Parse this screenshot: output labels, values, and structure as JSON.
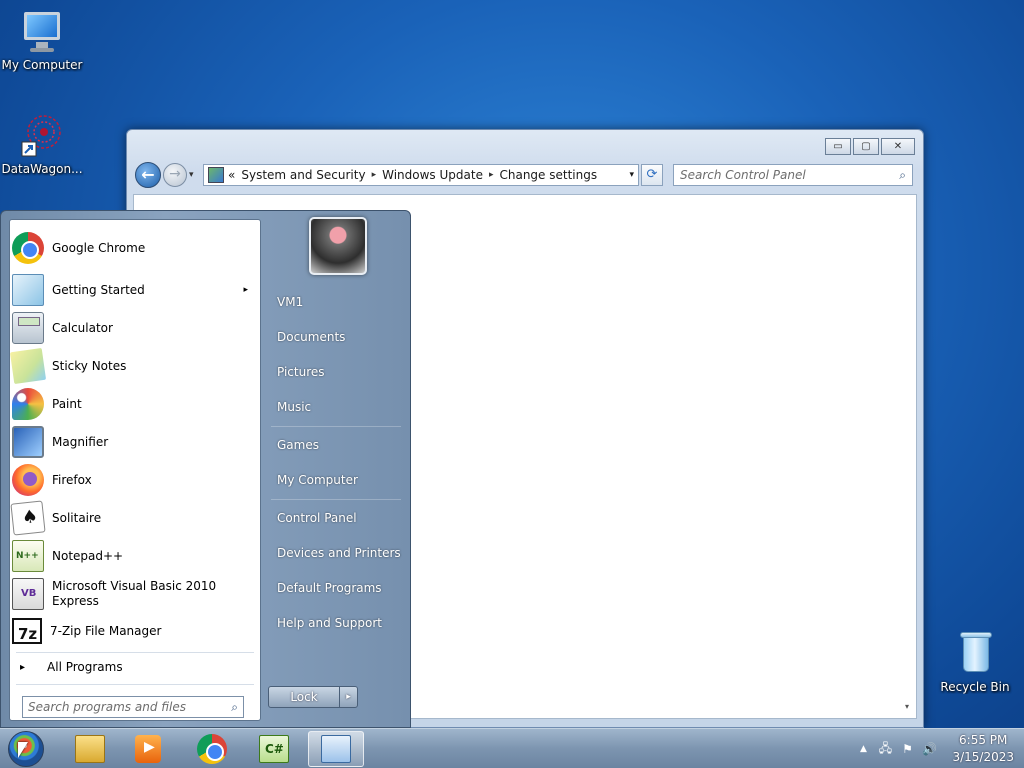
{
  "desktop": {
    "icons": [
      {
        "label": "My Computer"
      },
      {
        "label": "DataWagon..."
      },
      {
        "label": "Recycle Bin"
      }
    ]
  },
  "window": {
    "controls": {
      "minimize": "▭",
      "maximize": "▢",
      "close": "✕"
    },
    "nav": {
      "back": "←",
      "forward": "→",
      "dropdown": "▾"
    },
    "breadcrumb": {
      "prefix": "«",
      "items": [
        "System and Security",
        "Windows Update",
        "Change settings"
      ],
      "separator": "▸",
      "dropdown": "▾"
    },
    "refresh": "⟳",
    "search": {
      "placeholder": "Search Control Panel",
      "icon": "⌕"
    },
    "scroll_down": "▾"
  },
  "start_menu": {
    "programs": [
      {
        "label": "Google Chrome",
        "icon": "chrome-icon"
      },
      {
        "label": "Getting Started",
        "icon": "getting-started-icon",
        "arrow": "▸"
      },
      {
        "label": "Calculator",
        "icon": "calculator-icon"
      },
      {
        "label": "Sticky Notes",
        "icon": "sticky-notes-icon"
      },
      {
        "label": "Paint",
        "icon": "paint-icon"
      },
      {
        "label": "Magnifier",
        "icon": "magnifier-icon"
      },
      {
        "label": "Firefox",
        "icon": "firefox-icon"
      },
      {
        "label": "Solitaire",
        "icon": "solitaire-icon"
      },
      {
        "label": "Notepad++",
        "icon": "notepad-plus-plus-icon"
      },
      {
        "label": "Microsoft Visual Basic 2010",
        "label2": "Express",
        "icon": "visual-basic-icon"
      },
      {
        "label": "7-Zip File Manager",
        "icon": "seven-zip-icon"
      }
    ],
    "all_programs": {
      "label": "All Programs",
      "arrow": "▸"
    },
    "search": {
      "placeholder": "Search programs and files",
      "icon": "⌕"
    },
    "right_links": {
      "user": "VM1",
      "documents": "Documents",
      "pictures": "Pictures",
      "music": "Music",
      "games": "Games",
      "computer": "My Computer",
      "control_panel": "Control Panel",
      "devices": "Devices and Printers",
      "defaults": "Default Programs",
      "help": "Help and Support"
    },
    "lock": {
      "label": "Lock",
      "arrow": "▸"
    }
  },
  "taskbar": {
    "tray": {
      "show_hidden": "▲",
      "network": "🖧",
      "flag": "⚑",
      "volume": "🔊"
    },
    "clock": {
      "time": "6:55 PM",
      "date": "3/15/2023"
    }
  }
}
